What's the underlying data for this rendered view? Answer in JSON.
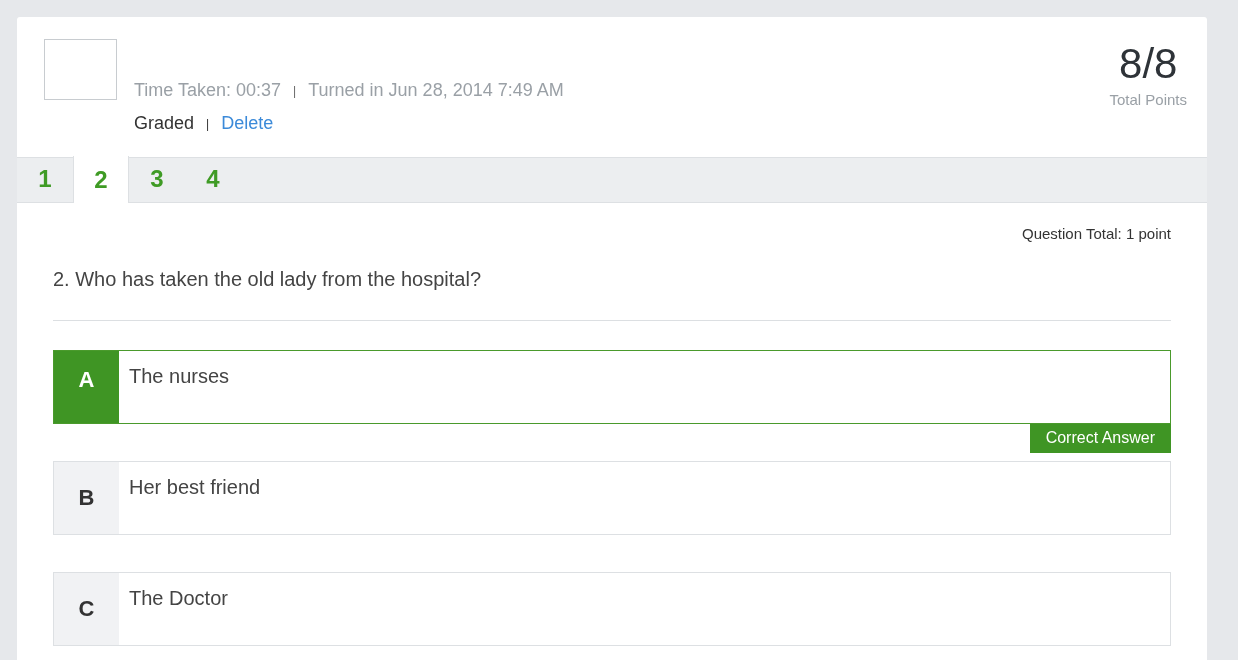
{
  "header": {
    "time_taken": "Time Taken: 00:37",
    "separator_1": "|",
    "turned_in": "Turned in Jun 28, 2014 7:49 AM",
    "status": "Graded",
    "separator_2": "|",
    "delete_link": "Delete",
    "score": "8/8",
    "score_label": "Total Points"
  },
  "tabs": [
    {
      "label": "1",
      "selected": false
    },
    {
      "label": "2",
      "selected": true
    },
    {
      "label": "3",
      "selected": false
    },
    {
      "label": "4",
      "selected": false
    }
  ],
  "question": {
    "total": "Question Total: 1 point",
    "text": "2. Who has taken the old lady from the hospital?"
  },
  "options": [
    {
      "letter": "A",
      "text": "The nurses",
      "correct": true,
      "badge": "Correct Answer"
    },
    {
      "letter": "B",
      "text": "Her best friend",
      "correct": false
    },
    {
      "letter": "C",
      "text": "The Doctor",
      "correct": false
    }
  ]
}
